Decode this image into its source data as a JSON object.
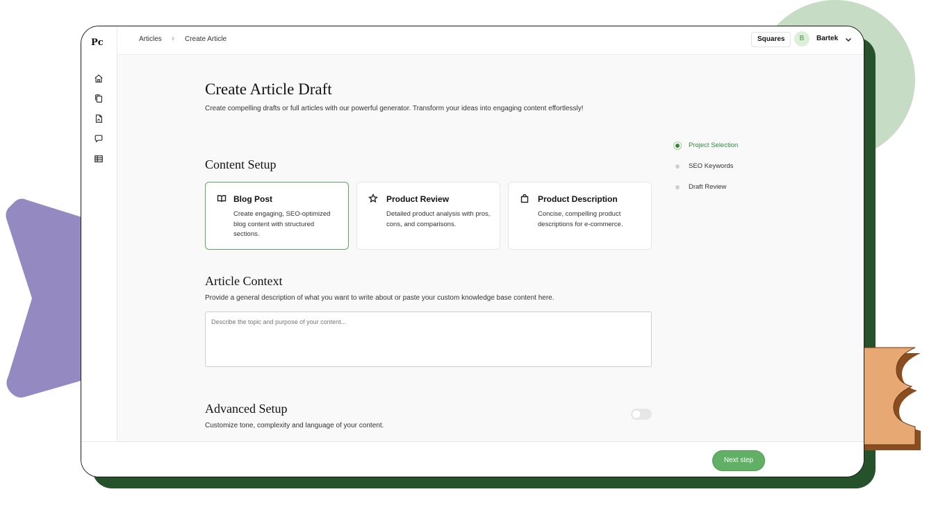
{
  "app": {
    "logo": "Pc"
  },
  "breadcrumb": {
    "items": [
      "Articles",
      "Create Article"
    ],
    "separator": "›"
  },
  "header": {
    "workspace": "Squares",
    "avatar_initial": "B",
    "user_name": "Bartek"
  },
  "sidebar": {
    "icons": [
      "home-icon",
      "documents-icon",
      "file-icon",
      "chat-icon",
      "table-icon"
    ]
  },
  "page": {
    "title": "Create Article Draft",
    "description": "Create compelling drafts or full articles with our powerful generator. Transform your ideas into engaging content effortlessly!"
  },
  "content_setup": {
    "title": "Content Setup",
    "cards": [
      {
        "icon": "book-icon",
        "title": "Blog Post",
        "description": "Create engaging, SEO-optimized blog content with structured sections.",
        "selected": true
      },
      {
        "icon": "star-icon",
        "title": "Product Review",
        "description": "Detailed product analysis with pros, cons, and comparisons.",
        "selected": false
      },
      {
        "icon": "shopping-bag-icon",
        "title": "Product Description",
        "description": "Concise, compelling product descriptions for e-commerce.",
        "selected": false
      }
    ]
  },
  "article_context": {
    "title": "Article Context",
    "description": "Provide a general description of what you want to write about or paste your custom knowledge base content here.",
    "placeholder": "Describe the topic and purpose of your content...",
    "value": ""
  },
  "advanced_setup": {
    "title": "Advanced Setup",
    "description": "Customize tone, complexity and language of your content.",
    "enabled": false
  },
  "steps": [
    {
      "label": "Project Selection",
      "active": true
    },
    {
      "label": "SEO Keywords",
      "active": false
    },
    {
      "label": "Draft Review",
      "active": false
    }
  ],
  "footer": {
    "next_label": "Next step"
  },
  "colors": {
    "accent": "#5aa85e",
    "accent_dark": "#25522a",
    "mint": "#c7dcc5",
    "lavender": "#9489c1",
    "peach": "#e8a874",
    "peach_shadow": "#8a4d1f"
  }
}
